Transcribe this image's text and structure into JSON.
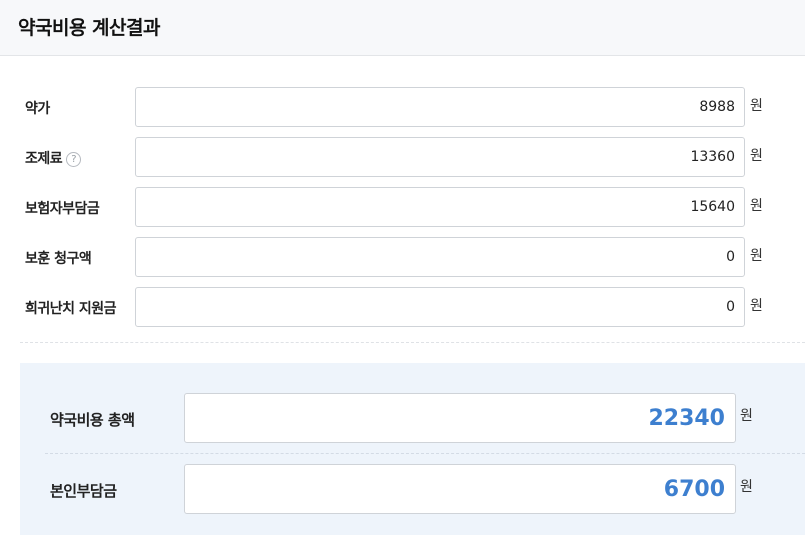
{
  "header": {
    "title": "약국비용 계산결과"
  },
  "fields": [
    {
      "label": "약가",
      "value": "8988",
      "unit": "원"
    },
    {
      "label": "조제료",
      "value": "13360",
      "unit": "원",
      "help_icon": "?"
    },
    {
      "label": "보험자부담금",
      "value": "15640",
      "unit": "원"
    },
    {
      "label": "보훈 청구액",
      "value": "0",
      "unit": "원"
    },
    {
      "label": "희귀난치 지원금",
      "value": "0",
      "unit": "원"
    }
  ],
  "summary": {
    "total": {
      "label": "약국비용 총액",
      "value": "22340",
      "unit": "원"
    },
    "copay": {
      "label": "본인부담금",
      "value": "6700",
      "unit": "원"
    }
  },
  "colors": {
    "accent": "#3d7fcf",
    "summary_bg": "#eef4fb",
    "header_bg": "#f7f8fa"
  }
}
